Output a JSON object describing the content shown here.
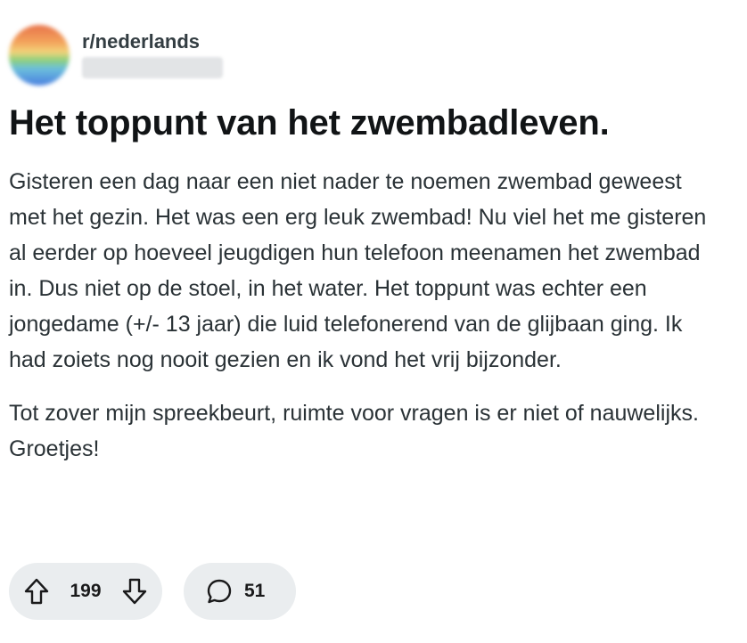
{
  "post": {
    "subreddit": "r/nederlands",
    "author": "",
    "title": "Het toppunt van het zwembadleven.",
    "paragraphs": [
      "Gisteren een dag naar een niet nader te noemen zwembad geweest met het gezin. Het was een erg leuk zwembad! Nu viel het me gisteren al eerder op hoeveel jeugdigen hun telefoon meenamen het zwembad in. Dus niet op de stoel, in het water. Het toppunt was echter een jongedame (+/- 13 jaar) die luid telefonerend van de glijbaan ging. Ik had zoiets nog nooit gezien en ik vond het vrij bijzonder.",
      "Tot zover mijn spreekbeurt, ruimte voor vragen is er niet of nauwelijks. Groetjes!"
    ]
  },
  "actions": {
    "upvote_icon": "arrow-up-icon",
    "vote_count": "199",
    "downvote_icon": "arrow-down-icon",
    "comment_icon": "speech-bubble-icon",
    "comment_count": "51"
  },
  "colors": {
    "pill_background": "#eaedef",
    "text": "#1a1a1b"
  }
}
